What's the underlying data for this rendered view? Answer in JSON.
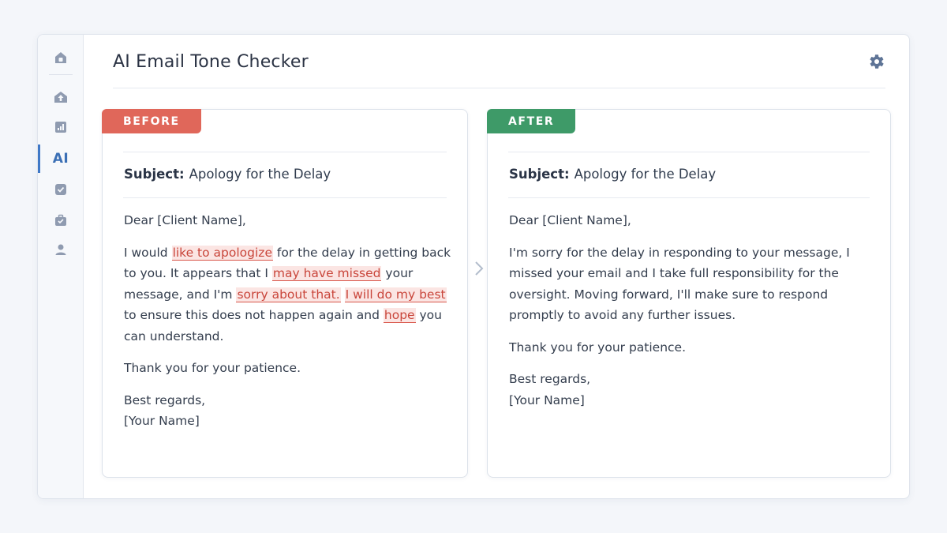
{
  "app": {
    "title": "AI Email Tone Checker"
  },
  "sidebar": {
    "items": [
      {
        "icon": "home-icon"
      },
      {
        "icon": "upload-icon"
      },
      {
        "icon": "chart-icon"
      },
      {
        "label": "AI",
        "active": true
      },
      {
        "icon": "check-icon"
      },
      {
        "icon": "briefcase-icon"
      },
      {
        "icon": "user-icon"
      }
    ]
  },
  "before": {
    "badge": "BEFORE",
    "subject_label": "Subject:",
    "subject": "Apology for the Delay",
    "greeting": "Dear [Client Name],",
    "para1": {
      "t1": "I would ",
      "h1": "like to apologize",
      "t2": " for the delay in getting back to you. It appears that I ",
      "h2": "may have missed",
      "t3": " your message, and I'm ",
      "h3": "sorry about that.",
      "t4": " ",
      "h4": "I will do my best",
      "t5": " to ensure this does not happen again and ",
      "h5": "hope",
      "t6": " you can understand."
    },
    "thanks": "Thank you for your patience.",
    "signoff": "Best regards,",
    "name": "[Your Name]"
  },
  "after": {
    "badge": "AFTER",
    "subject_label": "Subject:",
    "subject": "Apology for the Delay",
    "greeting": "Dear [Client Name],",
    "para1": "I'm sorry for the delay in responding to your message, I missed your email and I take full responsibility for the oversight. Moving forward, I'll make sure to respond promptly to avoid any further issues.",
    "thanks": "Thank you for your patience.",
    "signoff": "Best regards,",
    "name": "[Your Name]"
  },
  "colors": {
    "before_badge": "#e0675a",
    "after_badge": "#3e9a68",
    "highlight_text": "#c9463b",
    "highlight_bg": "#fbe5e3",
    "accent": "#3f78c7"
  }
}
